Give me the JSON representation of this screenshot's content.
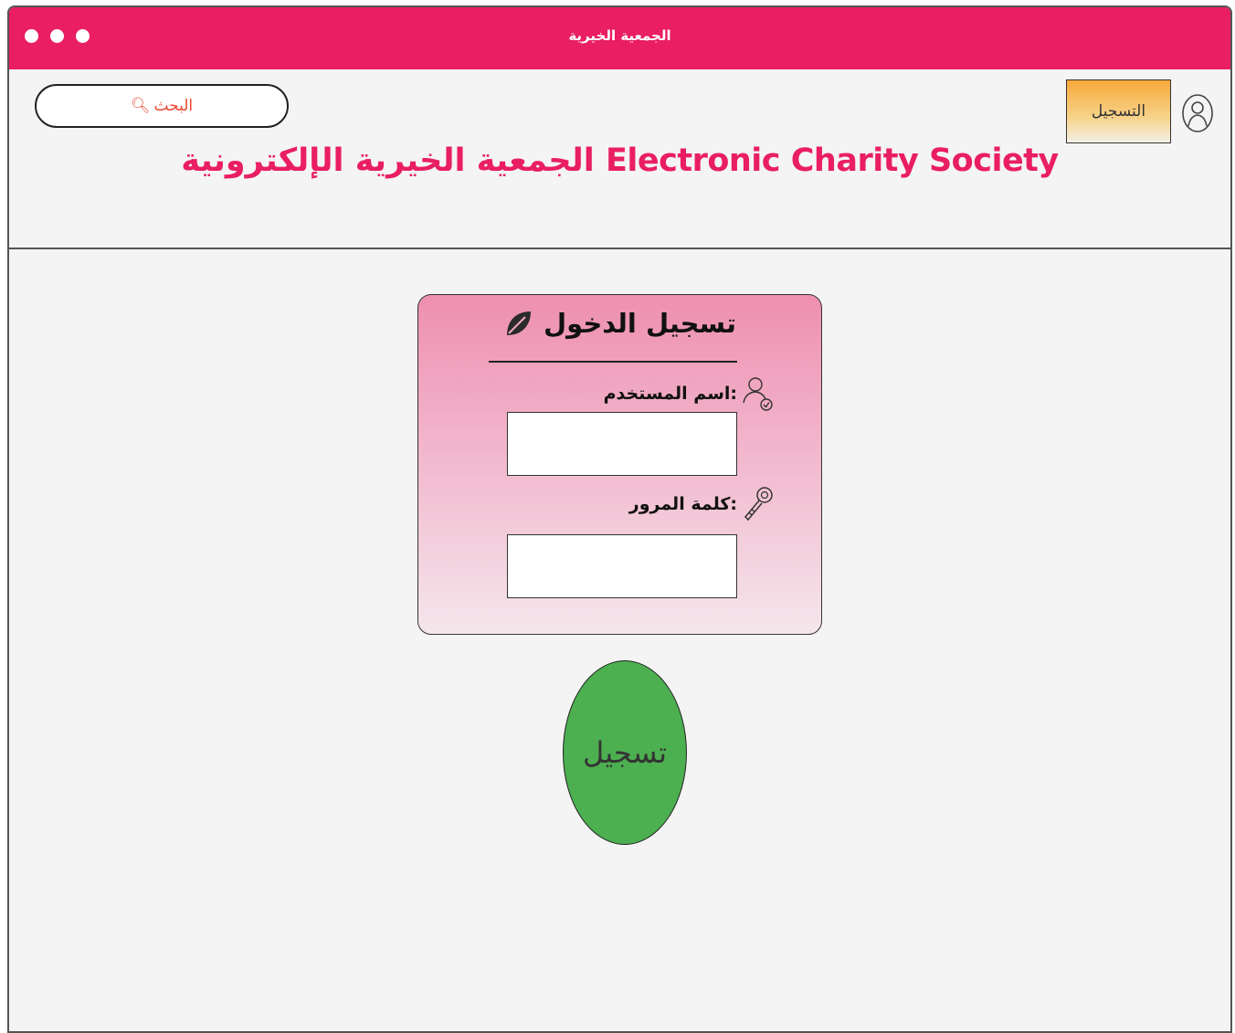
{
  "window": {
    "title": "الجمعية الخيرية"
  },
  "header": {
    "search_label": "البحث",
    "register_label": "التسجيل",
    "site_title": "الجمعية الخيرية الإلكترونية Electronic Charity Society"
  },
  "login": {
    "title": "تسجيل الدخول",
    "username_label": "اسم المستخدم:",
    "username_value": "",
    "password_label": "كلمة المرور:",
    "password_value": "",
    "submit_label": "تسجيل"
  },
  "colors": {
    "titlebar": "#e91e63",
    "site_title": "#e91e63",
    "search_text": "#e8472f",
    "submit_button": "#4caf50",
    "register_button": "#f7a83a"
  },
  "icons": {
    "search": "search-icon",
    "user": "user-icon",
    "leaf": "leaf-icon",
    "user_check": "user-check-icon",
    "key": "key-icon"
  }
}
